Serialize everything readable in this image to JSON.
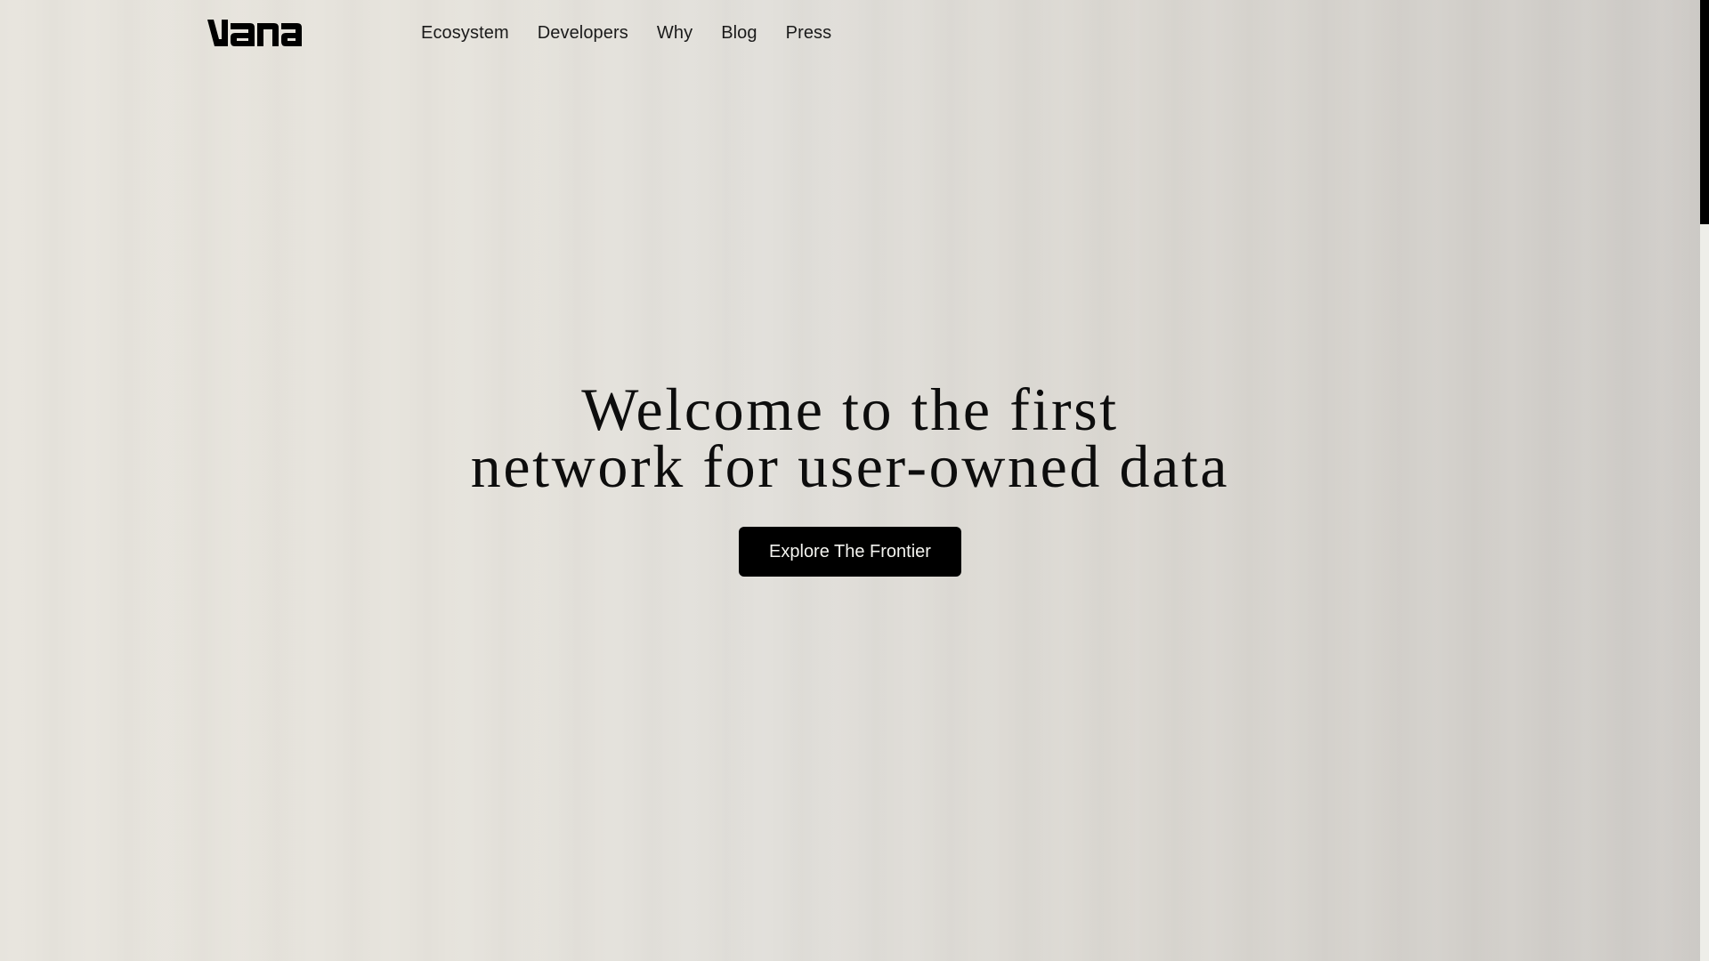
{
  "brand": {
    "name": "vana",
    "logo_icon": "vana-wordmark-logo"
  },
  "nav": {
    "items": [
      {
        "label": "Ecosystem"
      },
      {
        "label": "Developers"
      },
      {
        "label": "Why"
      },
      {
        "label": "Blog"
      },
      {
        "label": "Press"
      }
    ]
  },
  "hero": {
    "title_line1": "Welcome to the first",
    "title_line2": "network for user-owned data",
    "cta_label": "Explore The Frontier"
  },
  "colors": {
    "background_left": "#e7e4dd",
    "background_right": "#cfccc8",
    "text": "#111111",
    "cta_background": "#000000",
    "cta_text": "#f4f4f0",
    "scrollbar_thumb": "#000000",
    "scrollbar_track": "#eeeee9"
  },
  "scroll": {
    "position_fraction": 0.0
  }
}
